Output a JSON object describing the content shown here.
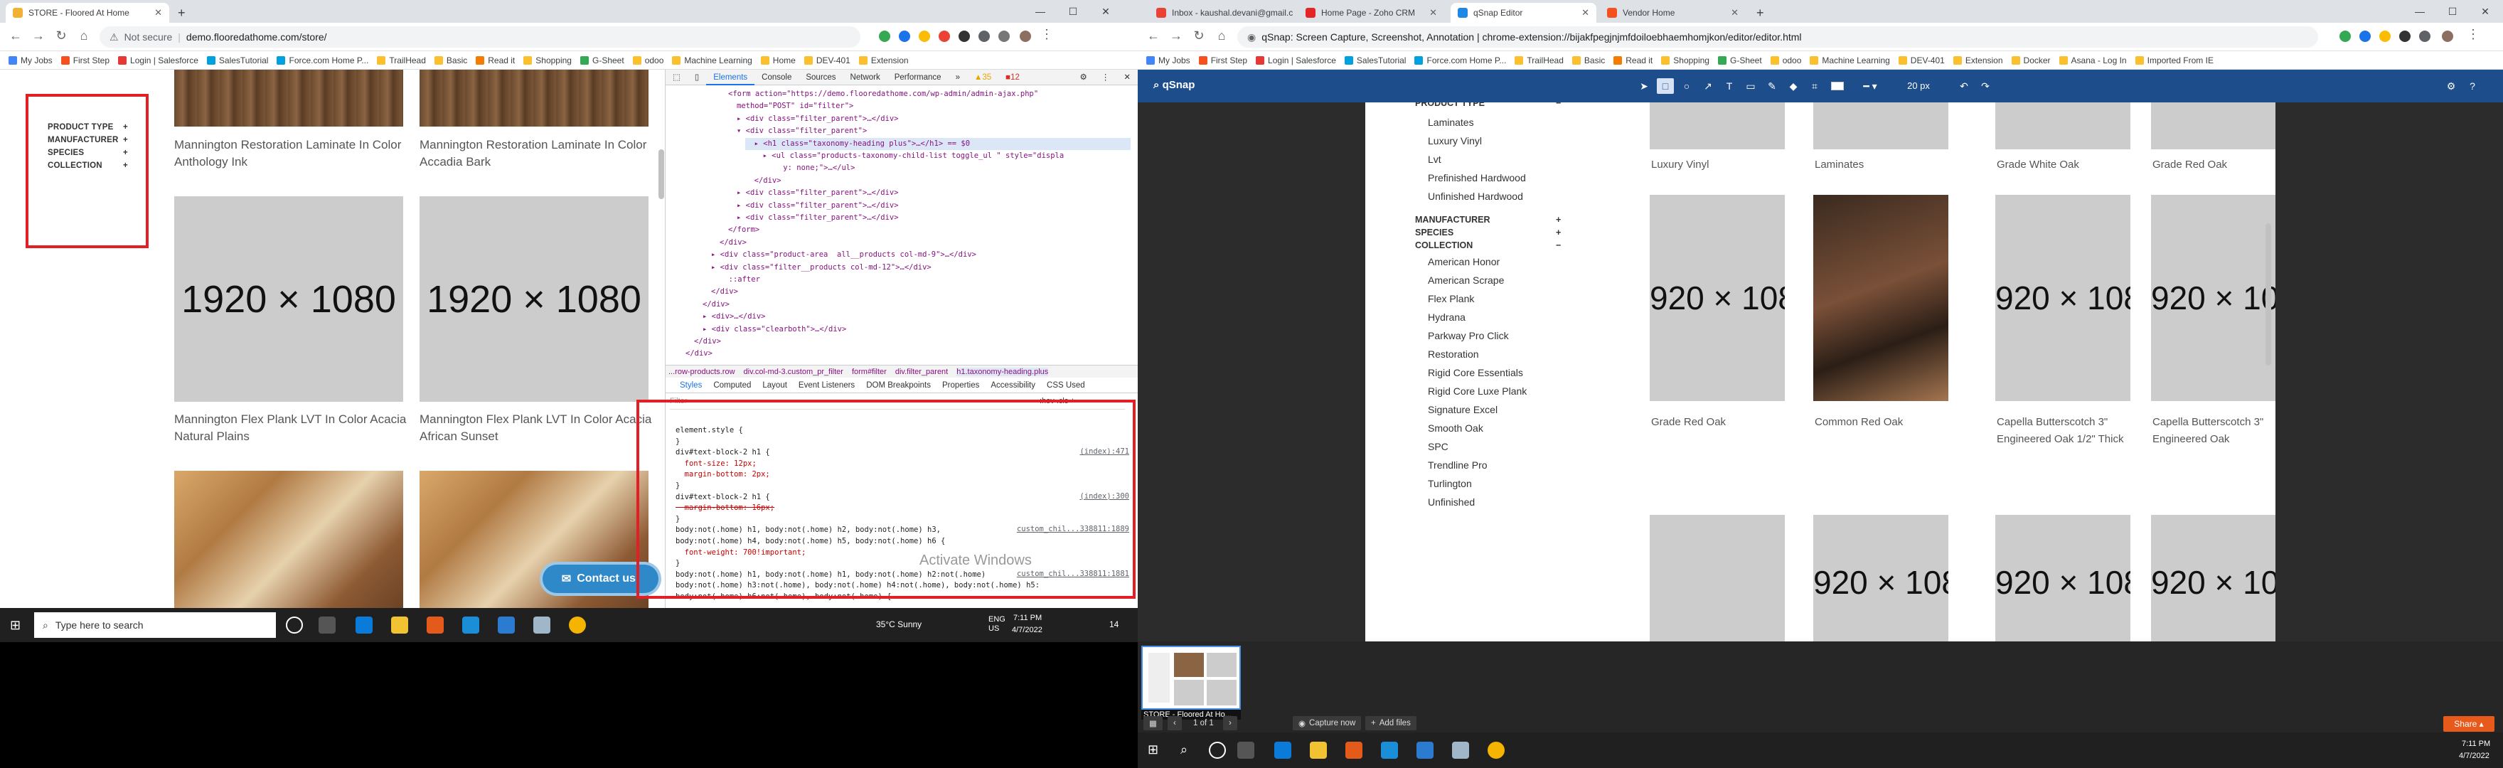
{
  "left": {
    "tabs": [
      {
        "title": "STORE - Floored At Home",
        "active": true,
        "favicon_color": "#f2b134"
      }
    ],
    "url": {
      "secure_label": "Not secure",
      "text": "demo.flooredathome.com/store/"
    },
    "bookmarks": [
      "My Jobs",
      "First Step",
      "Login | Salesforce",
      "SalesTutorial",
      "Force.com Home P...",
      "TrailHead",
      "Basic",
      "Read it",
      "Shopping",
      "G-Sheet",
      "odoo",
      "Machine Learning",
      "Home",
      "DEV-401",
      "Extension"
    ],
    "filters": [
      "PRODUCT TYPE",
      "MANUFACTURER",
      "SPECIES",
      "COLLECTION"
    ],
    "filter_sign": "+",
    "products": [
      {
        "title": "Mannington Restoration Laminate In Color Anthology Ink",
        "image": "wood"
      },
      {
        "title": "Mannington Restoration Laminate In Color Accadia Bark",
        "image": "wood"
      },
      {
        "title": "Mannington Flex Plank LVT In Color Acacia Natural Plains",
        "image": "placeholder"
      },
      {
        "title": "Mannington Flex Plank LVT In Color Acacia African Sunset",
        "image": "placeholder"
      },
      {
        "title": "",
        "image": "kitchen"
      },
      {
        "title": "",
        "image": "kitchen"
      }
    ],
    "placeholder_text": "1920 × 1080",
    "contact_label": "Contact us!",
    "activate_text": "Activate Windows",
    "devtools": {
      "tabs": [
        "Elements",
        "Console",
        "Sources",
        "Network",
        "Performance",
        "»"
      ],
      "active_tab": "Elements",
      "badges": {
        "warnings": "35",
        "errors": "12"
      },
      "html_lines": [
        "<form action=\"https://demo.flooredathome.com/wp-admin/admin-ajax.php\"",
        "method=\"POST\" id=\"filter\">",
        "▸ <div class=\"filter_parent\">…</div>",
        "▾ <div class=\"filter_parent\">",
        "  ▸ <h1 class=\"taxonomy-heading plus\">…</h1> == $0",
        "  ▸ <ul class=\"products-taxonomy-child-list toggle_ul \" style=\"displa",
        "    y: none;\">…</ul>",
        "  </div>",
        "▸ <div class=\"filter_parent\">…</div>",
        "▸ <div class=\"filter_parent\">…</div>",
        "▸ <div class=\"filter_parent\">…</div>",
        "</form>",
        "</div>",
        "▸ <div class=\"product-area  all__products col-md-9\">…</div>",
        "▸ <div class=\"filter__products col-md-12\">…</div>",
        "  ::after",
        "</div>",
        "</div>",
        "▸ <div>…</div>",
        "▸ <div class=\"clearboth\">…</div>",
        "</div>",
        "</div>"
      ],
      "breadcrumbs": [
        "...row-products.row",
        "div.col-md-3.custom_pr_filter",
        "form#filter",
        "div.filter_parent",
        "h1.taxonomy-heading.plus"
      ],
      "subtabs": [
        "Styles",
        "Computed",
        "Layout",
        "Event Listeners",
        "DOM Breakpoints",
        "Properties",
        "Accessibility",
        "CSS Used"
      ],
      "active_subtab": "Styles",
      "filter_placeholder": "Filter",
      "hov_cls": ":hov  .cls  +",
      "style_lines": [
        {
          "text": "element.style {",
          "src": ""
        },
        {
          "text": "}",
          "src": ""
        },
        {
          "text": "div#text-block-2 h1 {",
          "src": "(index):471"
        },
        {
          "text": "  font-size: 12px;",
          "src": ""
        },
        {
          "text": "  margin-bottom: 2px;",
          "src": ""
        },
        {
          "text": "}",
          "src": ""
        },
        {
          "text": "div#text-block-2 h1 {",
          "src": "(index):300"
        },
        {
          "text": "  margin-bottom: 16px;",
          "src": ""
        },
        {
          "text": "}",
          "src": ""
        },
        {
          "text": "body:not(.home) h1, body:not(.home) h2, body:not(.home) h3,",
          "src": "custom_chil...338811:1889"
        },
        {
          "text": "body:not(.home) h4, body:not(.home) h5, body:not(.home) h6 {",
          "src": ""
        },
        {
          "text": "  font-weight: 700!important;",
          "src": ""
        },
        {
          "text": "}",
          "src": ""
        },
        {
          "text": "body:not(.home) h1, body:not(.home) h1, body:not(.home) h2:not(.home)",
          "src": "custom_chil...338811:1881"
        },
        {
          "text": "body:not(.home) h3:not(.home), body:not(.home) h4:not(.home), body:not(.home) h5:",
          "src": ""
        },
        {
          "text": "body:not(.home) h6:not(.home), body:not(.home) {",
          "src": ""
        }
      ]
    },
    "taskbar": {
      "search_placeholder": "Type here to search",
      "weather": "35°C  Sunny",
      "lang": "ENG\nUS",
      "time": "7:11 PM",
      "date": "4/7/2022",
      "notif": "14"
    }
  },
  "right": {
    "tabs": [
      {
        "title": "Inbox - kaushal.devani@gmail.c",
        "active": false,
        "favicon_color": "#ea4335"
      },
      {
        "title": "Home Page - Zoho CRM",
        "active": false,
        "favicon_color": "#e42527"
      },
      {
        "title": "qSnap Editor",
        "active": true,
        "favicon_color": "#1e88e5"
      },
      {
        "title": "Vendor Home",
        "active": false,
        "favicon_color": "#f4511e"
      }
    ],
    "url": {
      "text": "qSnap: Screen Capture, Screenshot, Annotation  |  chrome-extension://bijakfpegjnjmfdoiloebhaemhomjkon/editor/editor.html"
    },
    "bookmarks": [
      "My Jobs",
      "First Step",
      "Login | Salesforce",
      "SalesTutorial",
      "Force.com Home P...",
      "TrailHead",
      "Basic",
      "Read it",
      "Shopping",
      "G-Sheet",
      "odoo",
      "Machine Learning",
      "DEV-401",
      "Extension",
      "Docker",
      "Asana - Log In",
      "Imported From IE"
    ],
    "app_name": "qSnap",
    "font_size": "20 px",
    "sidebar": {
      "product_type_label": "PRODUCT TYPE",
      "product_types": [
        "Laminates",
        "Luxury Vinyl",
        "Lvt",
        "Prefinished Hardwood",
        "Unfinished Hardwood"
      ],
      "headers": [
        {
          "label": "MANUFACTURER",
          "sign": "+"
        },
        {
          "label": "SPECIES",
          "sign": "+"
        },
        {
          "label": "COLLECTION",
          "sign": "−"
        }
      ],
      "collections": [
        "American Honor",
        "American Scrape",
        "Flex Plank",
        "Hydrana",
        "Parkway Pro Click",
        "Restoration",
        "Rigid Core Essentials",
        "Rigid Core Luxe Plank",
        "Signature Excel",
        "Smooth Oak",
        "SPC",
        "Trendline Pro",
        "Turlington",
        "Unfinished"
      ]
    },
    "grid_captions": [
      "Luxury Vinyl",
      "Laminates",
      "Grade White Oak",
      "Grade Red Oak",
      "Grade Red Oak",
      "Common Red Oak",
      "Capella Butterscotch 3\" Engineered Oak 1/2\" Thick",
      "Capella Butterscotch 3\" Engineered Oak"
    ],
    "placeholder_text": "920 × 108",
    "thumb_label": "STORE - Floored At Ho...",
    "pager": "1 of 1",
    "capture_label": "Capture now",
    "add_files_label": "Add files",
    "share_label": "Share",
    "time": "7:11 PM",
    "date": "4/7/2022"
  }
}
